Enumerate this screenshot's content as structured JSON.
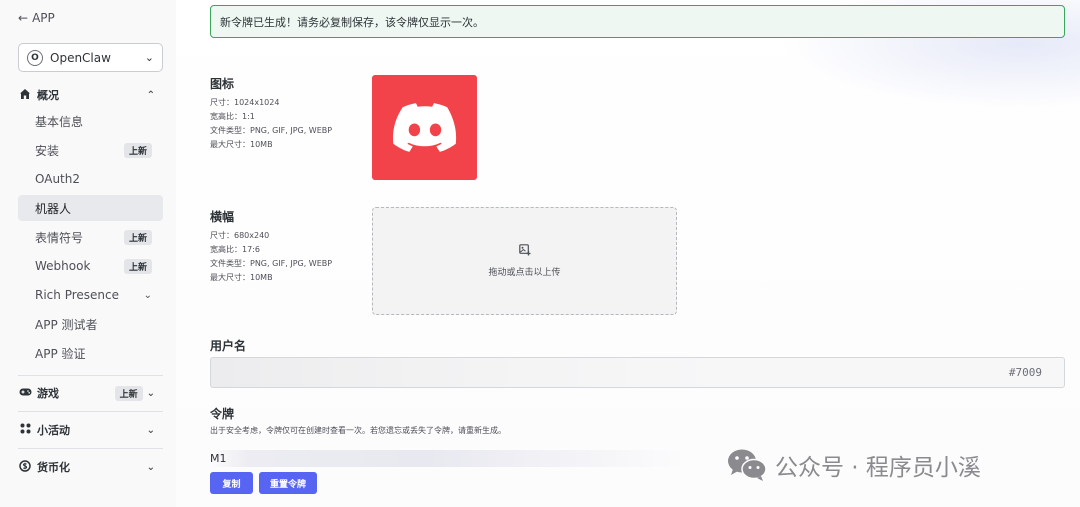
{
  "sidebar": {
    "back_label": "APP",
    "app_select": {
      "initial": "O",
      "name": "OpenClaw"
    },
    "overview": {
      "title": "概况",
      "items": [
        {
          "label": "基本信息"
        },
        {
          "label": "安装",
          "badge": "上新"
        },
        {
          "label": "OAuth2"
        },
        {
          "label": "机器人",
          "active": true
        },
        {
          "label": "表情符号",
          "badge": "上新"
        },
        {
          "label": "Webhook",
          "badge": "上新"
        },
        {
          "label": "Rich Presence"
        },
        {
          "label": "APP 测试者"
        },
        {
          "label": "APP 验证"
        }
      ]
    },
    "games": {
      "title": "游戏",
      "badge": "上新"
    },
    "activities": {
      "title": "小活动"
    },
    "monetization": {
      "title": "货币化"
    }
  },
  "alert": {
    "text": "新令牌已生成！请务必复制保存，该令牌仅显示一次。"
  },
  "icon_section": {
    "title": "图标",
    "spec": [
      "尺寸：1024x1024",
      "宽高比：1:1",
      "文件类型：PNG, GIF, JPG, WEBP",
      "最大尺寸：10MB"
    ]
  },
  "banner_section": {
    "title": "横幅",
    "spec": [
      "尺寸：680x240",
      "宽高比：17:6",
      "文件类型：PNG, GIF, JPG, WEBP",
      "最大尺寸：10MB"
    ],
    "upload_text": "拖动或点击以上传"
  },
  "username_section": {
    "title": "用户名",
    "discriminator": "#7009"
  },
  "token_section": {
    "title": "令牌",
    "description": "出于安全考虑，令牌仅可在创建时查看一次。若您遗忘或丢失了令牌，请重新生成。",
    "token_prefix": "M1",
    "copy_label": "复制",
    "reset_label": "重置令牌"
  },
  "watermark": {
    "text": "公众号 · 程序员小溪"
  },
  "colors": {
    "accent": "#5865f2",
    "success": "#3ba55c",
    "icon_bg": "#f2424a"
  }
}
